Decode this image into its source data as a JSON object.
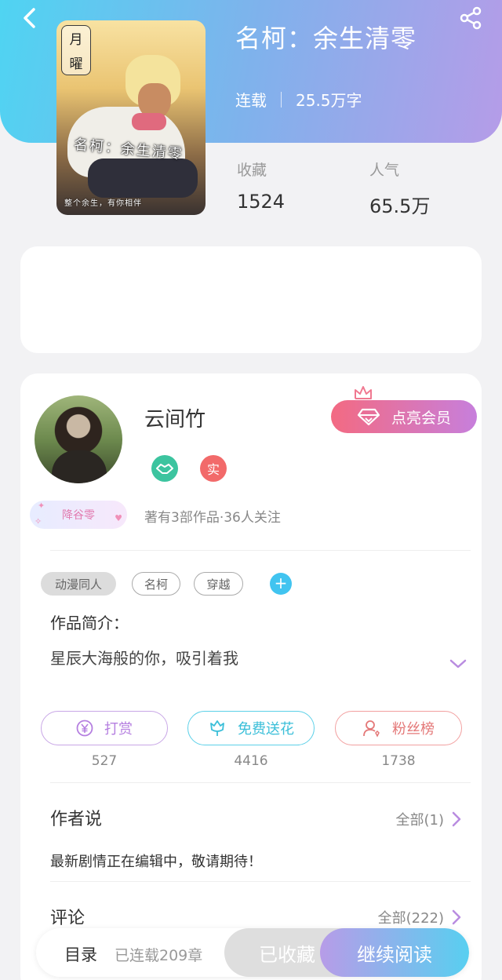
{
  "colors": {
    "header_gradient_start": "#4fd4f2",
    "header_gradient_end": "#b59ce8",
    "vip_gradient_start": "#f36a82",
    "vip_gradient_end": "#c77fdc",
    "read_gradient_start": "#b79ce8",
    "read_gradient_end": "#58cff0"
  },
  "header": {
    "back_icon": "chevron-left-icon",
    "share_icon": "share-icon"
  },
  "book": {
    "title": "名柯：余生清零",
    "status": "连载",
    "word_count": "25.5万字",
    "cover": {
      "badge_top": "月",
      "badge_bottom": "曜",
      "title": "名柯：余生清零",
      "subtitle": "整个余生，有你相伴"
    },
    "stats": [
      {
        "label": "收藏",
        "value": "1524"
      },
      {
        "label": "人气",
        "value": "65.5万"
      }
    ]
  },
  "author": {
    "name": "云间竹",
    "badge_sign_icon": "handshake-icon",
    "badge_real": "实",
    "fan_tag": "降谷零",
    "stats": "著有3部作品·36人关注",
    "vip_button": "点亮会员"
  },
  "tags": [
    "动漫同人",
    "名柯",
    "穿越"
  ],
  "intro": {
    "title": "作品简介：",
    "text": "星辰大海般的你，吸引着我"
  },
  "actions": [
    {
      "icon": "yen-icon",
      "label": "打赏",
      "count": "527"
    },
    {
      "icon": "flower-icon",
      "label": "免费送花",
      "count": "4416"
    },
    {
      "icon": "fans-icon",
      "label": "粉丝榜",
      "count": "1738"
    }
  ],
  "author_says": {
    "title": "作者说",
    "more": "全部(1)",
    "text": "最新剧情正在编辑中，敬请期待！"
  },
  "comments": {
    "title": "评论",
    "more": "全部(222)"
  },
  "bottom_bar": {
    "catalog": "目录",
    "chapters": "已连载209章",
    "collected": "已收藏",
    "read": "继续阅读"
  }
}
